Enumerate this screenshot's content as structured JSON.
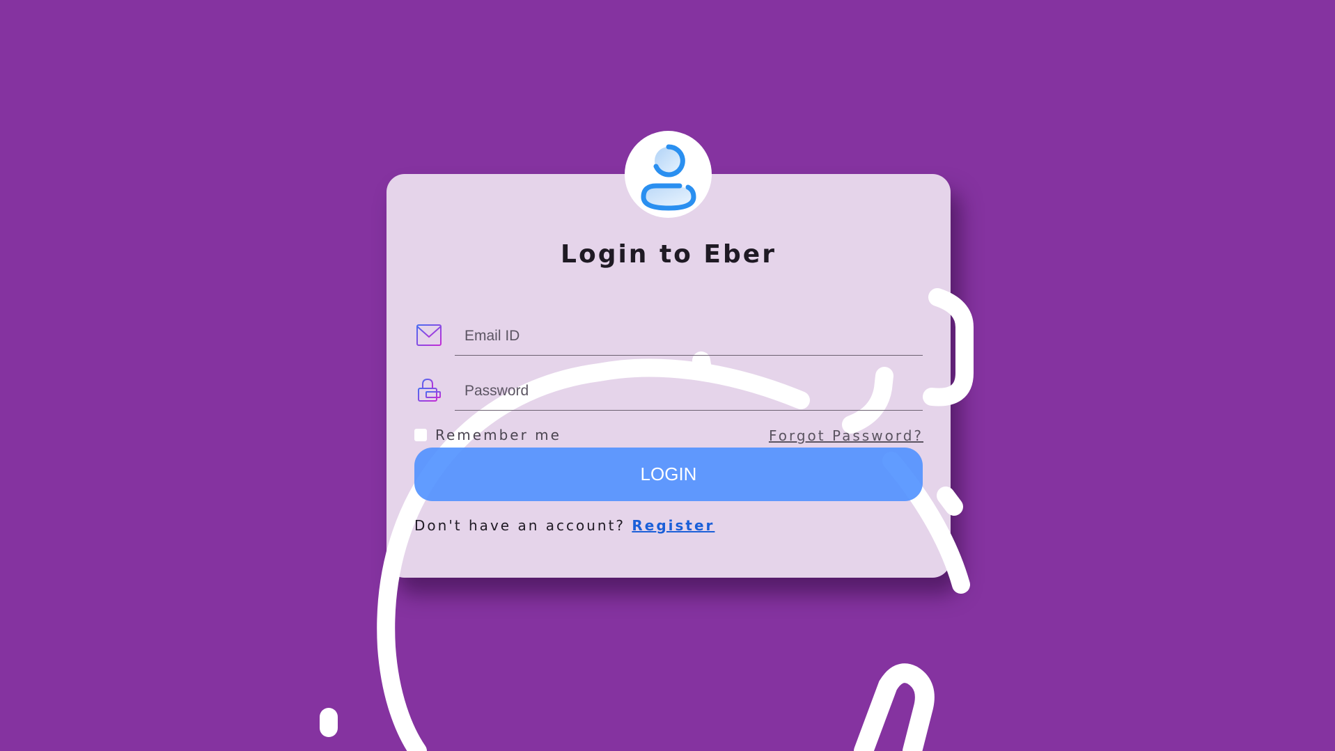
{
  "page": {
    "background_color": "#8533a0"
  },
  "header": {
    "avatar_icon": "user-avatar-icon",
    "title": "Login to Eber"
  },
  "form": {
    "email": {
      "icon": "envelope-icon",
      "placeholder": "Email ID",
      "value": ""
    },
    "password": {
      "icon": "lock-icon",
      "placeholder": "Password",
      "value": ""
    },
    "remember_label": "Remember me",
    "remember_checked": false,
    "forgot_label": "Forgot Password?",
    "login_label": "LOGIN"
  },
  "footer": {
    "prompt": "Don't have an account?",
    "register_label": "Register"
  },
  "colors": {
    "card": "#e8daec",
    "button": "#5091ff",
    "link": "#1a5fd8",
    "avatar_accent": "#2a8ff0"
  }
}
